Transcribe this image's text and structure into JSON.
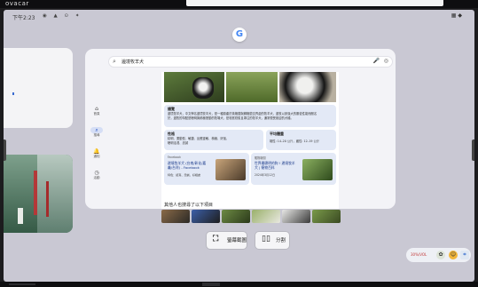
{
  "device": {
    "brand": "ovacar"
  },
  "status": {
    "time": "下午2:23",
    "icons": "◉ ▲ ⊙ ✦",
    "right_icons": "▦ ◆"
  },
  "google": {
    "letter": "G"
  },
  "search": {
    "query": "邊境牧羊犬",
    "mic": "🎤",
    "lens": "◎",
    "search_icon": "⌕"
  },
  "nav": [
    {
      "icon": "⌂",
      "label": "首頁"
    },
    {
      "icon": "⌕",
      "label": "搜尋"
    },
    {
      "icon": "🔔",
      "label": "通知"
    },
    {
      "icon": "◷",
      "label": "活動"
    }
  ],
  "result": {
    "overview_title": "總覽",
    "overview_text": [
      "邊境牧羊犬，中文學名邊境牧羊犬，是一種原產於英格蘭與蘇格蘭交界處的牧羊犬，邊牧以其強大的服從性能而聞名",
      "於，邊牧的特點是聰明與積極發動的牧場犬，是相當勤奮且專注的牧羊犬，通常很受歡迎的犬種。"
    ],
    "character_title": "性格",
    "character_text": [
      "精明、運動型、敏捷、反應靈敏、積極、好強、",
      "聰明活潑、忠誠"
    ],
    "weight_title": "平均體重",
    "weight_text": "雄性: 14–20 公斤，雌性: 12–19 公斤",
    "fb_source": "Facebook",
    "fb_title": "邊境牧羊犬 (台南/彰化/嘉義/台灣) - Facebook",
    "fb_desc": "特色：認真、忠誠、好相處",
    "news_source": "寵物新聞",
    "news_title": "世界最聰明的狗 ! 邊境牧羊犬 | 寵物百科",
    "news_desc": "2024年3月12日",
    "also_title": "其他人也搜尋了以下項目"
  },
  "buttons": {
    "capture_label": "螢幕截圖",
    "capture_icon": "⛶",
    "split_label": "分割",
    "split_icon": "▯▯"
  },
  "tray": {
    "volume": "30%/VOL",
    "t1": "✿",
    "t2": "☺",
    "t3": "⌗"
  },
  "colors": {
    "screen_bg": "#c9c8d3",
    "panel": "#e3e9f6",
    "accent": "#1f4fc2"
  }
}
